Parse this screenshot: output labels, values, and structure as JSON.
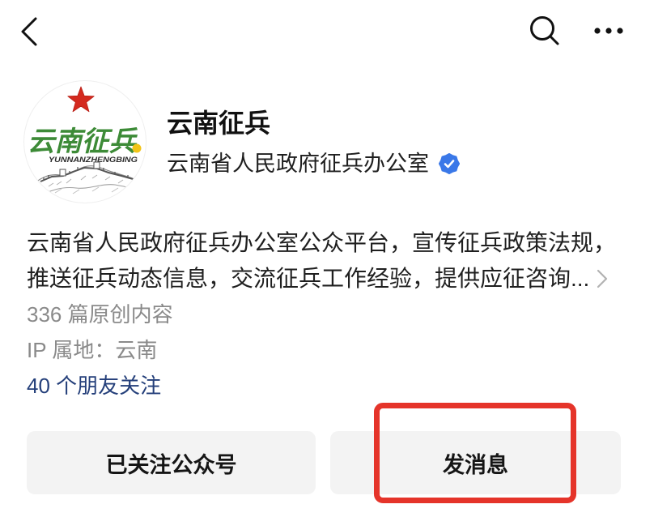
{
  "icons": {
    "back": "chevron-left-icon",
    "search": "search-icon",
    "more": "more-horizontal-icon",
    "verified": "verified-badge-icon",
    "description_more": "chevron-right-icon"
  },
  "account": {
    "avatar": {
      "logo_text": "云南征兵",
      "logo_subtext": "YUNNANZHENGBING",
      "logo_text_color": "#3d8b37",
      "star_color": "#d42a1f"
    },
    "name": "云南征兵",
    "organization": "云南省人民政府征兵办公室",
    "verified_color": "#3a78e8",
    "description_lines": [
      "云南省人民政府征兵办公室公众平台，宣传征兵政策法规，",
      "推送征兵动态信息，交流征兵工作经验，提供应征咨询..."
    ],
    "original_count": "336 篇原创内容",
    "ip_location": "IP 属地：云南",
    "friends_following": "40 个朋友关注",
    "link_color": "#243f7a"
  },
  "actions": {
    "follow_button": "已关注公众号",
    "message_button": "发消息"
  },
  "highlight": {
    "color": "#e5342a"
  }
}
